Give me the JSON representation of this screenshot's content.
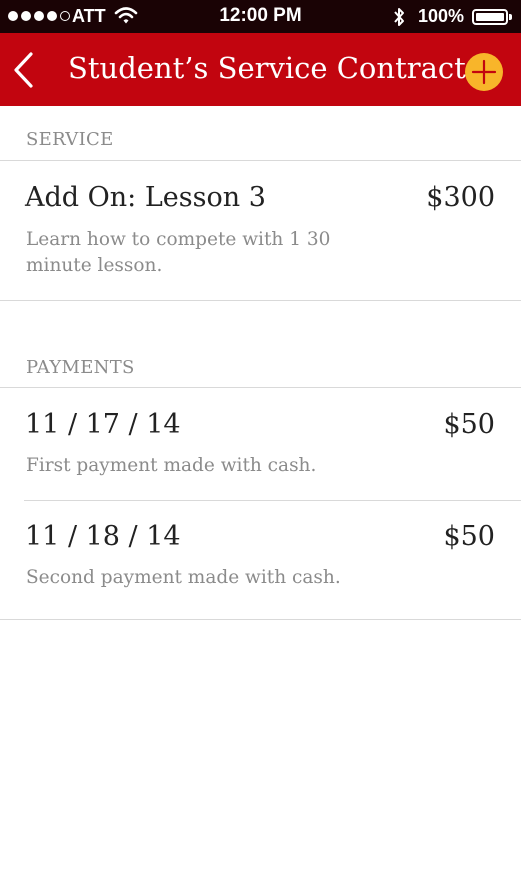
{
  "status_bar": {
    "carrier": "ATT",
    "time": "12:00 PM",
    "battery_percent": "100%",
    "signal_bars_filled": 4,
    "signal_bars_total": 5
  },
  "nav": {
    "title": "Student’s Service Contract",
    "back_icon": "chevron-left-icon",
    "add_icon": "plus-icon",
    "bar_color": "#c2050f",
    "add_color": "#f8b52a"
  },
  "service": {
    "header": "SERVICE",
    "items": [
      {
        "title": "Add On: Lesson 3",
        "amount": "$300",
        "description": "Learn how to compete with 1 30 minute lesson."
      }
    ]
  },
  "payments": {
    "header": "PAYMENTS",
    "items": [
      {
        "date": "11 / 17 / 14",
        "amount": "$50",
        "description": "First payment made with cash."
      },
      {
        "date": "11 / 18 / 14",
        "amount": "$50",
        "description": "Second payment made with cash."
      }
    ]
  }
}
